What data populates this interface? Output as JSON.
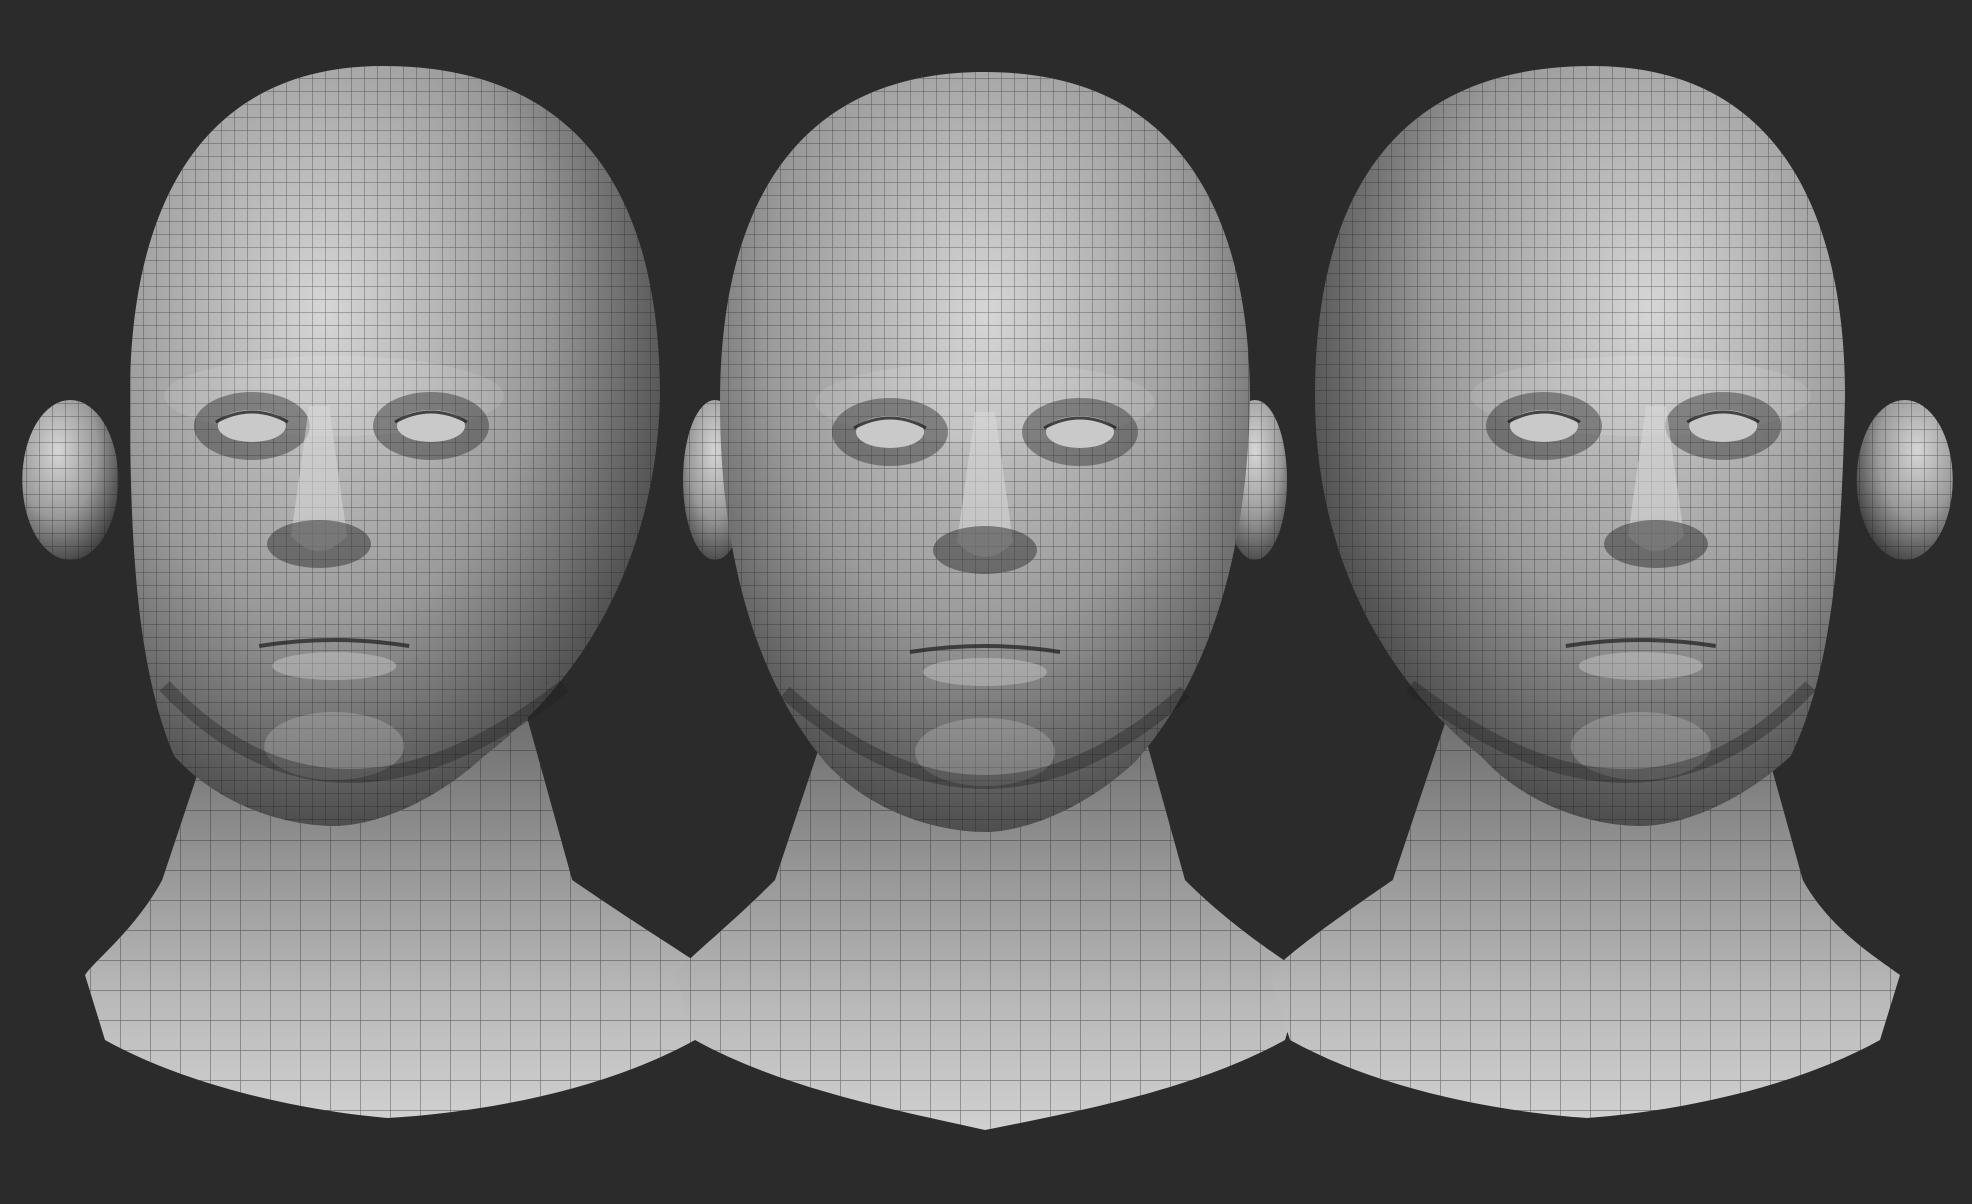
{
  "scene": {
    "background_color": "#2b2b2b",
    "material": {
      "skin_light": "#d6d6d6",
      "skin_mid": "#9a9a9a",
      "skin_dark": "#3a3a3a",
      "wire_color": "#1a1a1a"
    },
    "views": [
      {
        "name": "three-quarter-left",
        "yaw": -0.38
      },
      {
        "name": "front",
        "yaw": 0.0
      },
      {
        "name": "three-quarter-right",
        "yaw": 0.38
      }
    ]
  }
}
